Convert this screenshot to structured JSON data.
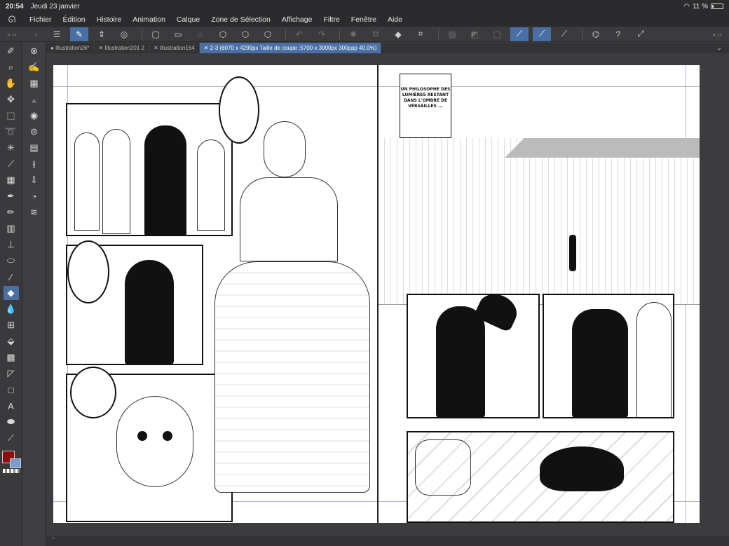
{
  "status": {
    "time": "20:54",
    "date": "Jeudi 23 janvier",
    "wifi_icon": "wifi-icon",
    "battery": "11 %"
  },
  "menu": {
    "logo_icon": "app-logo-icon",
    "items": [
      "Fichier",
      "Édition",
      "Histoire",
      "Animation",
      "Calque",
      "Zone de Sélection",
      "Affichage",
      "Filtre",
      "Fenêtre",
      "Aide"
    ]
  },
  "command_bar": {
    "left_edge": "« ‹‹",
    "right_edge": "« ‹‹",
    "icons": [
      "menu-icon",
      "snap-icon",
      "updown-icon",
      "layers-compare-icon",
      "new-file-icon",
      "open-folder-icon",
      "save-icon",
      "export-1-icon",
      "export-2-icon",
      "export-3-icon",
      "undo-icon",
      "redo-icon",
      "loading-icon",
      "transform-icon",
      "fill-icon",
      "crop-icon",
      "hide-icon",
      "tone-icon",
      "frame-icon",
      "ruler-snap-1-icon",
      "ruler-snap-2-icon",
      "ruler-snap-3-icon",
      "hat-icon",
      "help-icon",
      "fullscreen-icon"
    ]
  },
  "tabs": {
    "items": [
      {
        "label": "● Illustration26*",
        "active": false
      },
      {
        "label": "✕ Illustration201 2",
        "active": false
      },
      {
        "label": "✕ Illustration164",
        "active": false
      },
      {
        "label": "✕ 2-3 (6070 x 4299px Taille de coupe :5700 x 3900px 300ppp 40.0%)",
        "active": true
      }
    ],
    "chevron_icon": "chevron-down-icon"
  },
  "tools_left": [
    "brush-icon",
    "zoom-icon",
    "hand-icon",
    "move-icon",
    "marquee-icon",
    "lasso-icon",
    "magic-wand-icon",
    "eyedropper-icon",
    "pattern-icon",
    "pen-icon",
    "pencil-icon",
    "airbrush-icon",
    "fill-bucket-icon",
    "eraser-icon",
    "blend-icon",
    "ruler-icon",
    "eraser-active-icon",
    "water-drops-icon",
    "frame-icon",
    "paint-bucket-icon",
    "gradient-icon",
    "shape-icon",
    "rectangle-icon",
    "text-icon",
    "balloon-icon",
    "line-icon"
  ],
  "tools_right": [
    "navigator-icon",
    "edit-pen-icon",
    "grid-icon",
    "adjust-icon",
    "layer-prop-icon",
    "search-icon",
    "material-icon",
    "tone-icon",
    "upload-icon",
    "drops-icon",
    "layers-icon"
  ],
  "colors": {
    "main": "#8b0d0d",
    "sub": "#7a9ccf",
    "accent": "#4a6fa5"
  },
  "canvas": {
    "caption_text": "UN PHILOSOPHE DES LUMIÈRES RESTANT DANS L'OMBRE DE VERSAILLES ..."
  },
  "bottom": {
    "expand": "⌃"
  }
}
